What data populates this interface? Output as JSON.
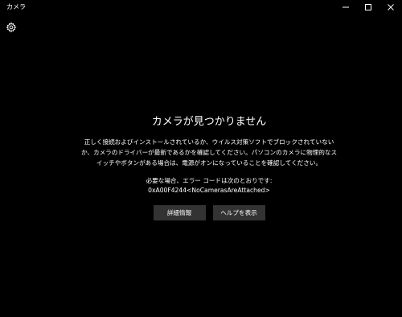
{
  "window": {
    "title": "カメラ",
    "controls": {
      "minimize_icon": "minimize-icon",
      "maximize_icon": "maximize-icon",
      "close_icon": "close-icon"
    }
  },
  "toolbar": {
    "settings_icon": "gear-icon"
  },
  "error": {
    "title": "カメラが見つかりません",
    "description": "正しく接続およびインストールされているか、ウイルス対策ソフトでブロックされていないか、カメラのドライバーが最新であるかを確認してください。パソコンのカメラに物理的なスイッチやボタンがある場合は、電源がオンになっていることを確認してください。",
    "code_label": "必要な場合、エラー コードは次のとおりです:",
    "code": "0xA00F4244<NoCamerasAreAttached>"
  },
  "buttons": {
    "details_label": "詳細情報",
    "help_label": "ヘルプを表示"
  },
  "colors": {
    "background": "#000000",
    "text": "#ffffff",
    "button_bg": "#333333"
  }
}
